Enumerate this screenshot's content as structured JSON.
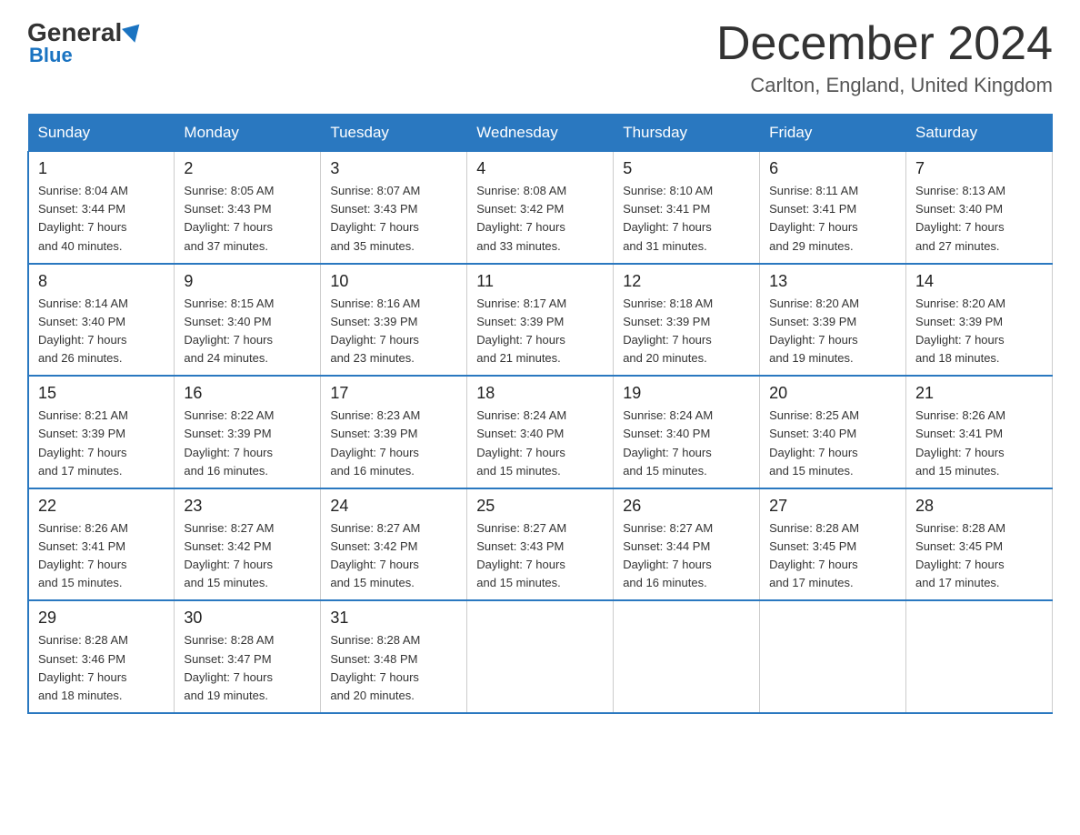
{
  "logo": {
    "general": "General",
    "blue": "Blue"
  },
  "header": {
    "month_year": "December 2024",
    "location": "Carlton, England, United Kingdom"
  },
  "days_of_week": [
    "Sunday",
    "Monday",
    "Tuesday",
    "Wednesday",
    "Thursday",
    "Friday",
    "Saturday"
  ],
  "weeks": [
    [
      {
        "date": "1",
        "sunrise": "8:04 AM",
        "sunset": "3:44 PM",
        "daylight": "7 hours and 40 minutes."
      },
      {
        "date": "2",
        "sunrise": "8:05 AM",
        "sunset": "3:43 PM",
        "daylight": "7 hours and 37 minutes."
      },
      {
        "date": "3",
        "sunrise": "8:07 AM",
        "sunset": "3:43 PM",
        "daylight": "7 hours and 35 minutes."
      },
      {
        "date": "4",
        "sunrise": "8:08 AM",
        "sunset": "3:42 PM",
        "daylight": "7 hours and 33 minutes."
      },
      {
        "date": "5",
        "sunrise": "8:10 AM",
        "sunset": "3:41 PM",
        "daylight": "7 hours and 31 minutes."
      },
      {
        "date": "6",
        "sunrise": "8:11 AM",
        "sunset": "3:41 PM",
        "daylight": "7 hours and 29 minutes."
      },
      {
        "date": "7",
        "sunrise": "8:13 AM",
        "sunset": "3:40 PM",
        "daylight": "7 hours and 27 minutes."
      }
    ],
    [
      {
        "date": "8",
        "sunrise": "8:14 AM",
        "sunset": "3:40 PM",
        "daylight": "7 hours and 26 minutes."
      },
      {
        "date": "9",
        "sunrise": "8:15 AM",
        "sunset": "3:40 PM",
        "daylight": "7 hours and 24 minutes."
      },
      {
        "date": "10",
        "sunrise": "8:16 AM",
        "sunset": "3:39 PM",
        "daylight": "7 hours and 23 minutes."
      },
      {
        "date": "11",
        "sunrise": "8:17 AM",
        "sunset": "3:39 PM",
        "daylight": "7 hours and 21 minutes."
      },
      {
        "date": "12",
        "sunrise": "8:18 AM",
        "sunset": "3:39 PM",
        "daylight": "7 hours and 20 minutes."
      },
      {
        "date": "13",
        "sunrise": "8:20 AM",
        "sunset": "3:39 PM",
        "daylight": "7 hours and 19 minutes."
      },
      {
        "date": "14",
        "sunrise": "8:20 AM",
        "sunset": "3:39 PM",
        "daylight": "7 hours and 18 minutes."
      }
    ],
    [
      {
        "date": "15",
        "sunrise": "8:21 AM",
        "sunset": "3:39 PM",
        "daylight": "7 hours and 17 minutes."
      },
      {
        "date": "16",
        "sunrise": "8:22 AM",
        "sunset": "3:39 PM",
        "daylight": "7 hours and 16 minutes."
      },
      {
        "date": "17",
        "sunrise": "8:23 AM",
        "sunset": "3:39 PM",
        "daylight": "7 hours and 16 minutes."
      },
      {
        "date": "18",
        "sunrise": "8:24 AM",
        "sunset": "3:40 PM",
        "daylight": "7 hours and 15 minutes."
      },
      {
        "date": "19",
        "sunrise": "8:24 AM",
        "sunset": "3:40 PM",
        "daylight": "7 hours and 15 minutes."
      },
      {
        "date": "20",
        "sunrise": "8:25 AM",
        "sunset": "3:40 PM",
        "daylight": "7 hours and 15 minutes."
      },
      {
        "date": "21",
        "sunrise": "8:26 AM",
        "sunset": "3:41 PM",
        "daylight": "7 hours and 15 minutes."
      }
    ],
    [
      {
        "date": "22",
        "sunrise": "8:26 AM",
        "sunset": "3:41 PM",
        "daylight": "7 hours and 15 minutes."
      },
      {
        "date": "23",
        "sunrise": "8:27 AM",
        "sunset": "3:42 PM",
        "daylight": "7 hours and 15 minutes."
      },
      {
        "date": "24",
        "sunrise": "8:27 AM",
        "sunset": "3:42 PM",
        "daylight": "7 hours and 15 minutes."
      },
      {
        "date": "25",
        "sunrise": "8:27 AM",
        "sunset": "3:43 PM",
        "daylight": "7 hours and 15 minutes."
      },
      {
        "date": "26",
        "sunrise": "8:27 AM",
        "sunset": "3:44 PM",
        "daylight": "7 hours and 16 minutes."
      },
      {
        "date": "27",
        "sunrise": "8:28 AM",
        "sunset": "3:45 PM",
        "daylight": "7 hours and 17 minutes."
      },
      {
        "date": "28",
        "sunrise": "8:28 AM",
        "sunset": "3:45 PM",
        "daylight": "7 hours and 17 minutes."
      }
    ],
    [
      {
        "date": "29",
        "sunrise": "8:28 AM",
        "sunset": "3:46 PM",
        "daylight": "7 hours and 18 minutes."
      },
      {
        "date": "30",
        "sunrise": "8:28 AM",
        "sunset": "3:47 PM",
        "daylight": "7 hours and 19 minutes."
      },
      {
        "date": "31",
        "sunrise": "8:28 AM",
        "sunset": "3:48 PM",
        "daylight": "7 hours and 20 minutes."
      },
      null,
      null,
      null,
      null
    ]
  ],
  "labels": {
    "sunrise": "Sunrise:",
    "sunset": "Sunset:",
    "daylight": "Daylight:"
  }
}
